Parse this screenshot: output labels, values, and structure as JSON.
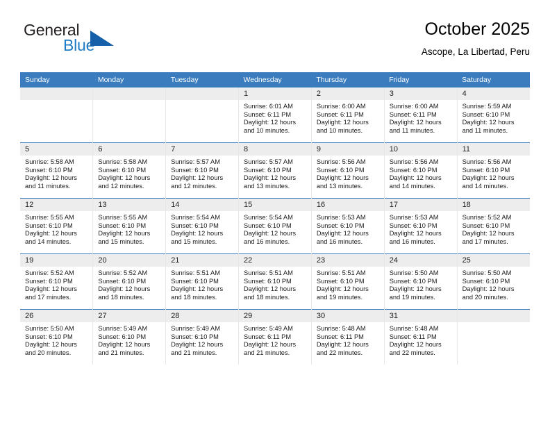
{
  "brand": {
    "name_part1": "General",
    "name_part2": "Blue",
    "flag_icon": "triangle-flag-icon",
    "accent_color": "#1560a8",
    "text_color": "#1e7bc4"
  },
  "header": {
    "title": "October 2025",
    "subtitle": "Ascope, La Libertad, Peru"
  },
  "calendar": {
    "header_background": "#3a7cbd",
    "day_band_background": "#ededed",
    "weekdays": [
      "Sunday",
      "Monday",
      "Tuesday",
      "Wednesday",
      "Thursday",
      "Friday",
      "Saturday"
    ],
    "weeks": [
      [
        {
          "day": "",
          "empty": true
        },
        {
          "day": "",
          "empty": true
        },
        {
          "day": "",
          "empty": true
        },
        {
          "day": "1",
          "sunrise": "Sunrise: 6:01 AM",
          "sunset": "Sunset: 6:11 PM",
          "daylight_line1": "Daylight: 12 hours",
          "daylight_line2": "and 10 minutes."
        },
        {
          "day": "2",
          "sunrise": "Sunrise: 6:00 AM",
          "sunset": "Sunset: 6:11 PM",
          "daylight_line1": "Daylight: 12 hours",
          "daylight_line2": "and 10 minutes."
        },
        {
          "day": "3",
          "sunrise": "Sunrise: 6:00 AM",
          "sunset": "Sunset: 6:11 PM",
          "daylight_line1": "Daylight: 12 hours",
          "daylight_line2": "and 11 minutes."
        },
        {
          "day": "4",
          "sunrise": "Sunrise: 5:59 AM",
          "sunset": "Sunset: 6:10 PM",
          "daylight_line1": "Daylight: 12 hours",
          "daylight_line2": "and 11 minutes."
        }
      ],
      [
        {
          "day": "5",
          "sunrise": "Sunrise: 5:58 AM",
          "sunset": "Sunset: 6:10 PM",
          "daylight_line1": "Daylight: 12 hours",
          "daylight_line2": "and 11 minutes."
        },
        {
          "day": "6",
          "sunrise": "Sunrise: 5:58 AM",
          "sunset": "Sunset: 6:10 PM",
          "daylight_line1": "Daylight: 12 hours",
          "daylight_line2": "and 12 minutes."
        },
        {
          "day": "7",
          "sunrise": "Sunrise: 5:57 AM",
          "sunset": "Sunset: 6:10 PM",
          "daylight_line1": "Daylight: 12 hours",
          "daylight_line2": "and 12 minutes."
        },
        {
          "day": "8",
          "sunrise": "Sunrise: 5:57 AM",
          "sunset": "Sunset: 6:10 PM",
          "daylight_line1": "Daylight: 12 hours",
          "daylight_line2": "and 13 minutes."
        },
        {
          "day": "9",
          "sunrise": "Sunrise: 5:56 AM",
          "sunset": "Sunset: 6:10 PM",
          "daylight_line1": "Daylight: 12 hours",
          "daylight_line2": "and 13 minutes."
        },
        {
          "day": "10",
          "sunrise": "Sunrise: 5:56 AM",
          "sunset": "Sunset: 6:10 PM",
          "daylight_line1": "Daylight: 12 hours",
          "daylight_line2": "and 14 minutes."
        },
        {
          "day": "11",
          "sunrise": "Sunrise: 5:56 AM",
          "sunset": "Sunset: 6:10 PM",
          "daylight_line1": "Daylight: 12 hours",
          "daylight_line2": "and 14 minutes."
        }
      ],
      [
        {
          "day": "12",
          "sunrise": "Sunrise: 5:55 AM",
          "sunset": "Sunset: 6:10 PM",
          "daylight_line1": "Daylight: 12 hours",
          "daylight_line2": "and 14 minutes."
        },
        {
          "day": "13",
          "sunrise": "Sunrise: 5:55 AM",
          "sunset": "Sunset: 6:10 PM",
          "daylight_line1": "Daylight: 12 hours",
          "daylight_line2": "and 15 minutes."
        },
        {
          "day": "14",
          "sunrise": "Sunrise: 5:54 AM",
          "sunset": "Sunset: 6:10 PM",
          "daylight_line1": "Daylight: 12 hours",
          "daylight_line2": "and 15 minutes."
        },
        {
          "day": "15",
          "sunrise": "Sunrise: 5:54 AM",
          "sunset": "Sunset: 6:10 PM",
          "daylight_line1": "Daylight: 12 hours",
          "daylight_line2": "and 16 minutes."
        },
        {
          "day": "16",
          "sunrise": "Sunrise: 5:53 AM",
          "sunset": "Sunset: 6:10 PM",
          "daylight_line1": "Daylight: 12 hours",
          "daylight_line2": "and 16 minutes."
        },
        {
          "day": "17",
          "sunrise": "Sunrise: 5:53 AM",
          "sunset": "Sunset: 6:10 PM",
          "daylight_line1": "Daylight: 12 hours",
          "daylight_line2": "and 16 minutes."
        },
        {
          "day": "18",
          "sunrise": "Sunrise: 5:52 AM",
          "sunset": "Sunset: 6:10 PM",
          "daylight_line1": "Daylight: 12 hours",
          "daylight_line2": "and 17 minutes."
        }
      ],
      [
        {
          "day": "19",
          "sunrise": "Sunrise: 5:52 AM",
          "sunset": "Sunset: 6:10 PM",
          "daylight_line1": "Daylight: 12 hours",
          "daylight_line2": "and 17 minutes."
        },
        {
          "day": "20",
          "sunrise": "Sunrise: 5:52 AM",
          "sunset": "Sunset: 6:10 PM",
          "daylight_line1": "Daylight: 12 hours",
          "daylight_line2": "and 18 minutes."
        },
        {
          "day": "21",
          "sunrise": "Sunrise: 5:51 AM",
          "sunset": "Sunset: 6:10 PM",
          "daylight_line1": "Daylight: 12 hours",
          "daylight_line2": "and 18 minutes."
        },
        {
          "day": "22",
          "sunrise": "Sunrise: 5:51 AM",
          "sunset": "Sunset: 6:10 PM",
          "daylight_line1": "Daylight: 12 hours",
          "daylight_line2": "and 18 minutes."
        },
        {
          "day": "23",
          "sunrise": "Sunrise: 5:51 AM",
          "sunset": "Sunset: 6:10 PM",
          "daylight_line1": "Daylight: 12 hours",
          "daylight_line2": "and 19 minutes."
        },
        {
          "day": "24",
          "sunrise": "Sunrise: 5:50 AM",
          "sunset": "Sunset: 6:10 PM",
          "daylight_line1": "Daylight: 12 hours",
          "daylight_line2": "and 19 minutes."
        },
        {
          "day": "25",
          "sunrise": "Sunrise: 5:50 AM",
          "sunset": "Sunset: 6:10 PM",
          "daylight_line1": "Daylight: 12 hours",
          "daylight_line2": "and 20 minutes."
        }
      ],
      [
        {
          "day": "26",
          "sunrise": "Sunrise: 5:50 AM",
          "sunset": "Sunset: 6:10 PM",
          "daylight_line1": "Daylight: 12 hours",
          "daylight_line2": "and 20 minutes."
        },
        {
          "day": "27",
          "sunrise": "Sunrise: 5:49 AM",
          "sunset": "Sunset: 6:10 PM",
          "daylight_line1": "Daylight: 12 hours",
          "daylight_line2": "and 21 minutes."
        },
        {
          "day": "28",
          "sunrise": "Sunrise: 5:49 AM",
          "sunset": "Sunset: 6:10 PM",
          "daylight_line1": "Daylight: 12 hours",
          "daylight_line2": "and 21 minutes."
        },
        {
          "day": "29",
          "sunrise": "Sunrise: 5:49 AM",
          "sunset": "Sunset: 6:11 PM",
          "daylight_line1": "Daylight: 12 hours",
          "daylight_line2": "and 21 minutes."
        },
        {
          "day": "30",
          "sunrise": "Sunrise: 5:48 AM",
          "sunset": "Sunset: 6:11 PM",
          "daylight_line1": "Daylight: 12 hours",
          "daylight_line2": "and 22 minutes."
        },
        {
          "day": "31",
          "sunrise": "Sunrise: 5:48 AM",
          "sunset": "Sunset: 6:11 PM",
          "daylight_line1": "Daylight: 12 hours",
          "daylight_line2": "and 22 minutes."
        },
        {
          "day": "",
          "empty": true
        }
      ]
    ]
  }
}
